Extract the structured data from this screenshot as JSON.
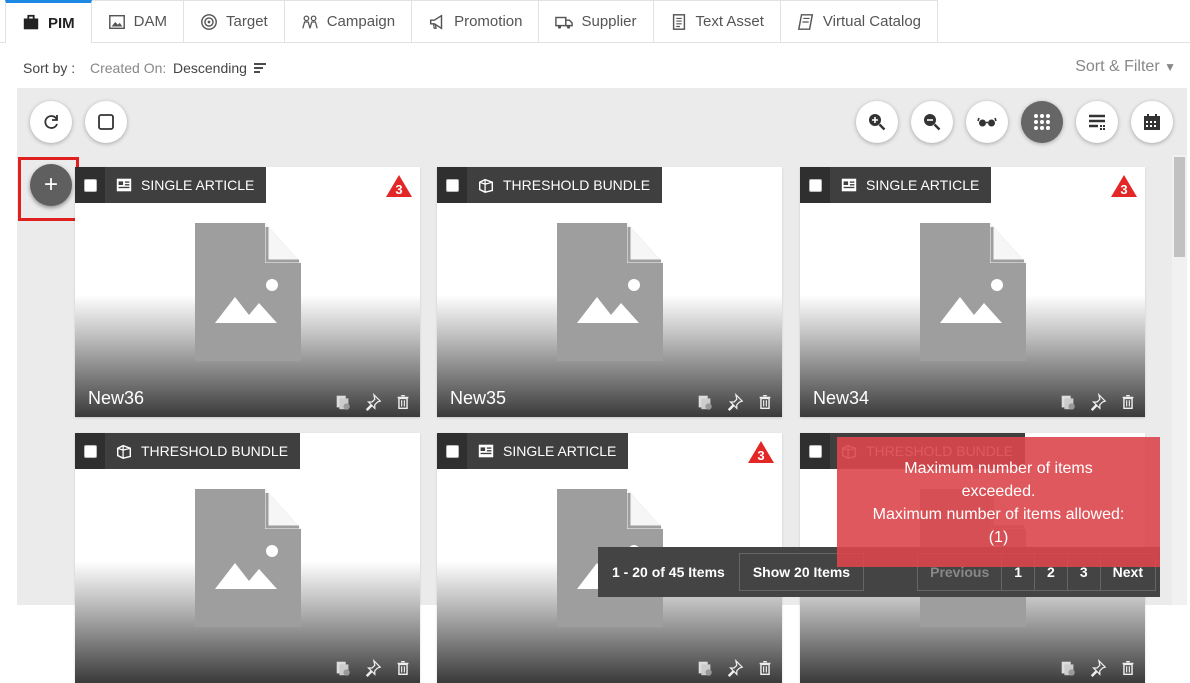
{
  "tabs": [
    {
      "label": "PIM",
      "icon": "briefcase-icon",
      "active": true
    },
    {
      "label": "DAM",
      "icon": "image-icon"
    },
    {
      "label": "Target",
      "icon": "target-icon"
    },
    {
      "label": "Campaign",
      "icon": "people-icon"
    },
    {
      "label": "Promotion",
      "icon": "megaphone-icon"
    },
    {
      "label": "Supplier",
      "icon": "truck-icon"
    },
    {
      "label": "Text Asset",
      "icon": "document-icon"
    },
    {
      "label": "Virtual Catalog",
      "icon": "book-icon"
    }
  ],
  "sort": {
    "label": "Sort by :",
    "key": "Created On:",
    "value": "Descending",
    "filter": "Sort & Filter"
  },
  "cards": [
    {
      "type": "SINGLE ARTICLE",
      "name": "New36",
      "badge": "3"
    },
    {
      "type": "THRESHOLD BUNDLE",
      "name": "New35",
      "badge": ""
    },
    {
      "type": "SINGLE ARTICLE",
      "name": "New34",
      "badge": "3"
    },
    {
      "type": "THRESHOLD BUNDLE",
      "name": "",
      "badge": ""
    },
    {
      "type": "SINGLE ARTICLE",
      "name": "",
      "badge": "3"
    },
    {
      "type": "THRESHOLD BUNDLE",
      "name": "",
      "badge": ""
    }
  ],
  "pager": {
    "info": "1 - 20 of 45 Items",
    "show": "Show 20 Items",
    "prev": "Previous",
    "pages": [
      "1",
      "2",
      "3"
    ],
    "next": "Next"
  },
  "toast": {
    "line1": "Maximum number of items",
    "line2": "exceeded.",
    "line3": "Maximum number of items allowed:",
    "line4": "(1)"
  },
  "colors": {
    "accent": "#1e88e5",
    "toast": "#dc464b",
    "highlight": "#e01f1f"
  }
}
